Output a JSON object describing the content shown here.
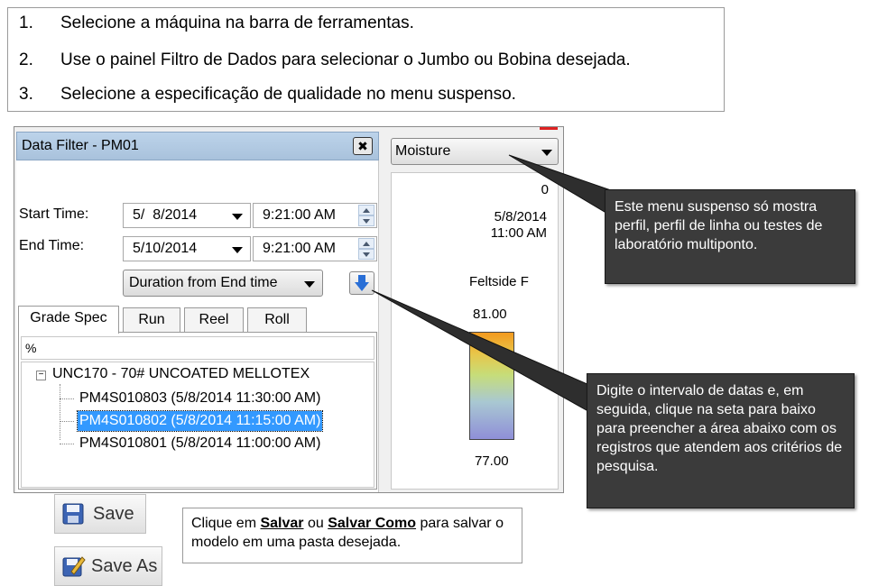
{
  "instructions": [
    {
      "num": "1.",
      "text": "Selecione a máquina na barra de ferramentas."
    },
    {
      "num": "2.",
      "text": "Use o painel Filtro de Dados para selecionar o Jumbo ou Bobina desejada."
    },
    {
      "num": "3.",
      "text": "Selecione a especificação de qualidade no menu suspenso."
    }
  ],
  "data_filter": {
    "title": "Data Filter - PM01",
    "close_glyph": "✖",
    "start_time_label": "Start Time:",
    "end_time_label": "End Time:",
    "start_date": "5/  8/2014",
    "start_time": "9:21:00 AM",
    "end_date": "5/10/2014",
    "end_time": "9:21:00 AM",
    "duration_option": "Duration from End time",
    "tabs": [
      "Grade Spec",
      "Run",
      "Reel",
      "Roll"
    ],
    "active_tab": "Grade Spec",
    "grade_filter": "%",
    "tree": {
      "expander": "−",
      "root": "UNC170 - 70# UNCOATED MELLOTEX",
      "items": [
        "PM4S010803 (5/8/2014 11:30:00 AM)",
        "PM4S010802 (5/8/2014 11:15:00 AM)",
        "PM4S010801 (5/8/2014 11:00:00 AM)"
      ],
      "selected_index": 1
    }
  },
  "right_panel": {
    "parameter": "Moisture",
    "value_top": "0",
    "date": "5/8/2014",
    "time": "11:00 AM",
    "label": "Feltside F",
    "max": "81.00",
    "min": "77.00"
  },
  "callouts": {
    "dropdown_note": "Este menu suspenso só mostra perfil, perfil de linha ou testes de laboratório multiponto.",
    "date_note": "Digite o intervalo de datas e, em seguida, clique na seta para baixo para preencher a área abaixo com os registros que atendem aos critérios de pesquisa."
  },
  "buttons": {
    "save": "Save",
    "save_as": "Save As"
  },
  "info": {
    "prefix": "Clique em ",
    "save_word": "Salvar",
    "middle": " ou ",
    "save_as_word": "Salvar Como",
    "suffix": " para salvar o modelo em uma pasta desejada."
  },
  "colors": {
    "header_blue": "#b0c8e2",
    "selection_blue": "#3399ff",
    "callout_bg": "#3b3b3b"
  }
}
